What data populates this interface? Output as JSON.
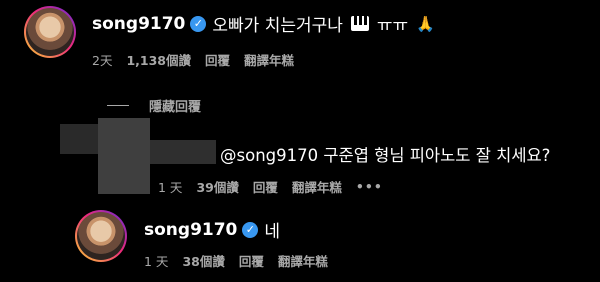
{
  "comments": [
    {
      "username": "song9170",
      "text": "오빠가 치는거구나",
      "emoji_text": "ㅠㅠ",
      "time": "2天",
      "likes": "1,138個讚",
      "reply_label": "回覆",
      "translate_label": "翻譯年糕"
    },
    {
      "text": "@song9170 구준엽 형님 피아노도 잘 치세요?",
      "time": "1 天",
      "likes": "39個讚",
      "reply_label": "回覆",
      "translate_label": "翻譯年糕",
      "more": "•••"
    },
    {
      "username": "song9170",
      "text": "네",
      "time": "1 天",
      "likes": "38個讚",
      "reply_label": "回覆",
      "translate_label": "翻譯年糕"
    }
  ],
  "hidden_replies_label": "隱藏回覆",
  "icons": {
    "verified": "verified-badge-icon",
    "piano": "piano-icon",
    "pray": "folded-hands-icon",
    "more": "more-options-icon"
  },
  "colors": {
    "background": "#000000",
    "text": "#ffffff",
    "meta": "#a8a8a8",
    "verified": "#3897f0"
  }
}
